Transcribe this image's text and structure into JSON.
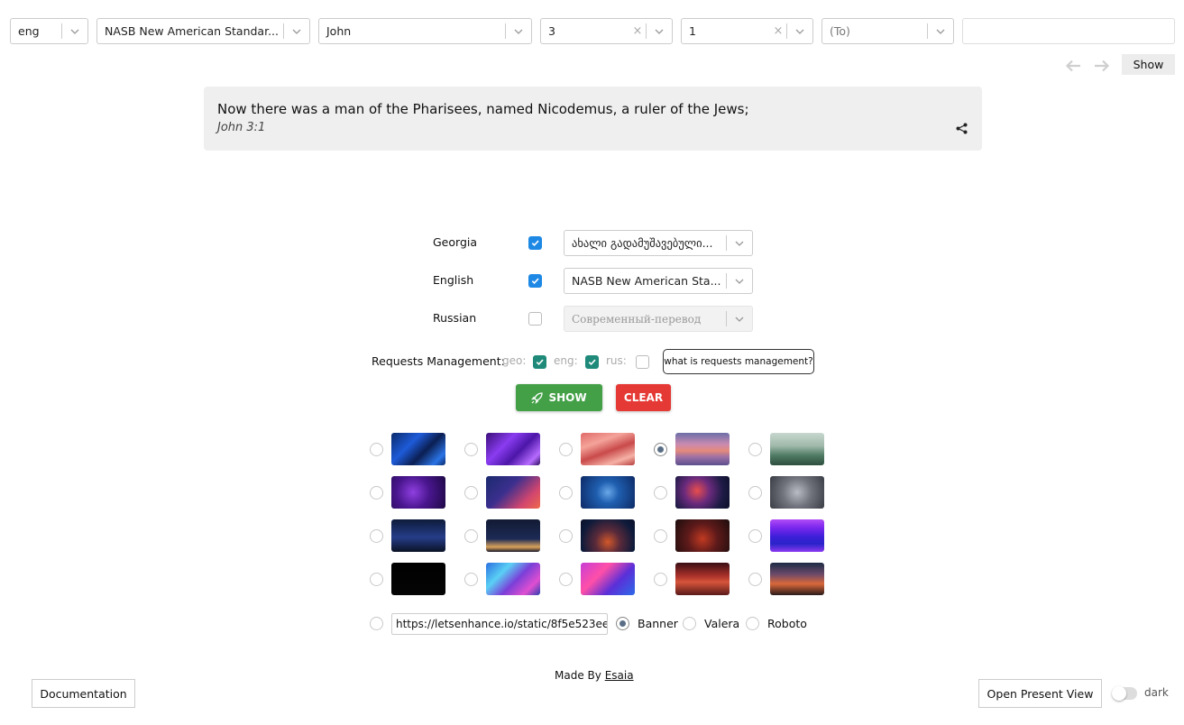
{
  "toolbar": {
    "language": "eng",
    "translation": "NASB New American Standar...",
    "book": "John",
    "chapter": "3",
    "verse": "1",
    "to_placeholder": "(To)",
    "clear_symbol": "×",
    "show_label": "Show"
  },
  "verse": {
    "text": "Now there was a man of the Pharisees, named Nicodemus, a ruler of the Jews;",
    "reference": "John 3:1",
    "share_icon": "share-icon"
  },
  "languages": [
    {
      "label": "Georgia",
      "checked": true,
      "translation": "ახალი გადამუშავებული..."
    },
    {
      "label": "English",
      "checked": true,
      "translation": "NASB New American Sta..."
    },
    {
      "label": "Russian",
      "checked": false,
      "translation": "Современный-перевод"
    }
  ],
  "requests": {
    "label": "Requests Management:",
    "geo": "geo:",
    "eng": "eng:",
    "rus": "rus:",
    "geo_checked": true,
    "eng_checked": true,
    "rus_checked": false,
    "help_button": "what is requests management?"
  },
  "actions": {
    "show": "SHOW",
    "clear": "CLEAR",
    "show_icon": "rocket-icon"
  },
  "backgrounds": {
    "selected_index": 3,
    "count": 20
  },
  "custom": {
    "url": "https://letsenhance.io/static/8f5e523ee",
    "fonts": [
      "Banner",
      "Valera",
      "Roboto"
    ],
    "selected_font": "Banner"
  },
  "footer": {
    "made_by": "Made By",
    "author": "Esaia",
    "documentation": "Documentation",
    "present_view": "Open Present View",
    "dark_label": "dark",
    "dark_enabled": false
  },
  "colors": {
    "show_green": "#43a047",
    "clear_red": "#e53935",
    "checkbox_blue": "#1e88e5",
    "checkbox_teal": "#1f8a7a"
  }
}
